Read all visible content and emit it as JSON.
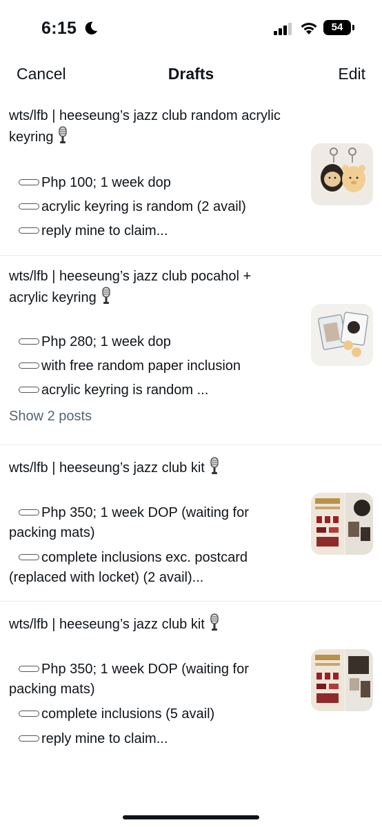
{
  "status_bar": {
    "time": "6:15",
    "battery": "54"
  },
  "nav": {
    "cancel_label": "Cancel",
    "title": "Drafts",
    "edit_label": "Edit"
  },
  "drafts": [
    {
      "title_line1": "wts/lfb | heeseung’s jazz club random acrylic",
      "title_line2": "keyring",
      "bullets": [
        "Php 100; 1 week dop",
        "acrylic keyring is random (2 avail)",
        "reply mine to claim..."
      ]
    },
    {
      "title_line1": "wts/lfb | heeseung’s jazz club pocahol +",
      "title_line2": "acrylic keyring",
      "bullets": [
        "Php 280; 1 week dop",
        "with free random paper inclusion",
        "acrylic keyring is random ..."
      ],
      "show_more": "Show 2 posts"
    },
    {
      "title_line1": "wts/lfb | heeseung’s jazz club kit",
      "bullet1_line1": "Php 350; 1 week DOP (waiting for",
      "bullet1_line2": "packing mats)",
      "bullet2_line1": "complete inclusions exc. postcard",
      "bullet2_line2": "(replaced with locket) (2 avail)..."
    },
    {
      "title_line1": "wts/lfb | heeseung’s jazz club kit",
      "bullet1_line1": "Php 350; 1 week DOP (waiting for",
      "bullet1_line2": "packing mats)",
      "bullets": [
        "complete inclusions (5 avail)",
        "reply mine to claim..."
      ]
    }
  ],
  "icons": {
    "moon": "moon-icon",
    "signal": "cellular-signal-icon",
    "wifi": "wifi-icon",
    "microphone": "microphone-emoji-icon"
  },
  "colors": {
    "text": "#0f1419",
    "secondary": "#536471",
    "divider": "#e6e9ec"
  }
}
